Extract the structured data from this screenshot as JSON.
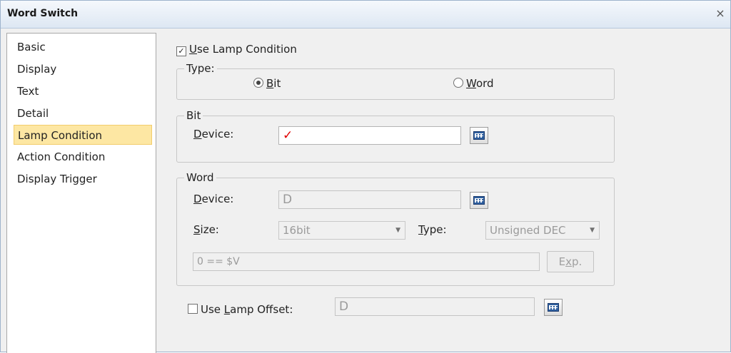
{
  "window": {
    "title": "Word Switch",
    "close_glyph": "×"
  },
  "sidebar": {
    "items": [
      {
        "label": "Basic"
      },
      {
        "label": "Display"
      },
      {
        "label": "Text"
      },
      {
        "label": "Detail"
      },
      {
        "label": "Lamp Condition",
        "selected": true
      },
      {
        "label": "Action Condition"
      },
      {
        "label": "Display Trigger"
      }
    ]
  },
  "lamp": {
    "use_lamp_condition": {
      "prefix": "",
      "mnemonic": "U",
      "rest": "se Lamp Condition",
      "checked": true,
      "check_glyph": "✓"
    },
    "type_group": {
      "legend": "Type:",
      "bit": {
        "mnemonic": "B",
        "rest": "it",
        "selected": true
      },
      "word": {
        "mnemonic": "W",
        "rest": "ord",
        "selected": false
      }
    },
    "bit_group": {
      "legend": "Bit",
      "device_mnemonic": "D",
      "device_rest": "evice:",
      "device_value": "✓"
    },
    "word_group": {
      "legend": "Word",
      "device_mnemonic": "D",
      "device_rest": "evice:",
      "device_value": "D",
      "size_mnemonic": "S",
      "size_rest": "ize:",
      "size_value": "16bit",
      "type_mnemonic": "T",
      "type_rest": "ype:",
      "type_value": "Unsigned DEC",
      "expression": "0 == $V",
      "exp_button": {
        "prefix": "E",
        "mnemonic": "x",
        "rest": "p."
      }
    },
    "lamp_offset": {
      "prefix": "Use ",
      "mnemonic": "L",
      "rest": "amp Offset:",
      "checked": false,
      "value": "D"
    }
  },
  "colors": {
    "selected_bg": "#fde7a3",
    "check_red": "#e00000",
    "titlebar": "#dde7f3"
  }
}
